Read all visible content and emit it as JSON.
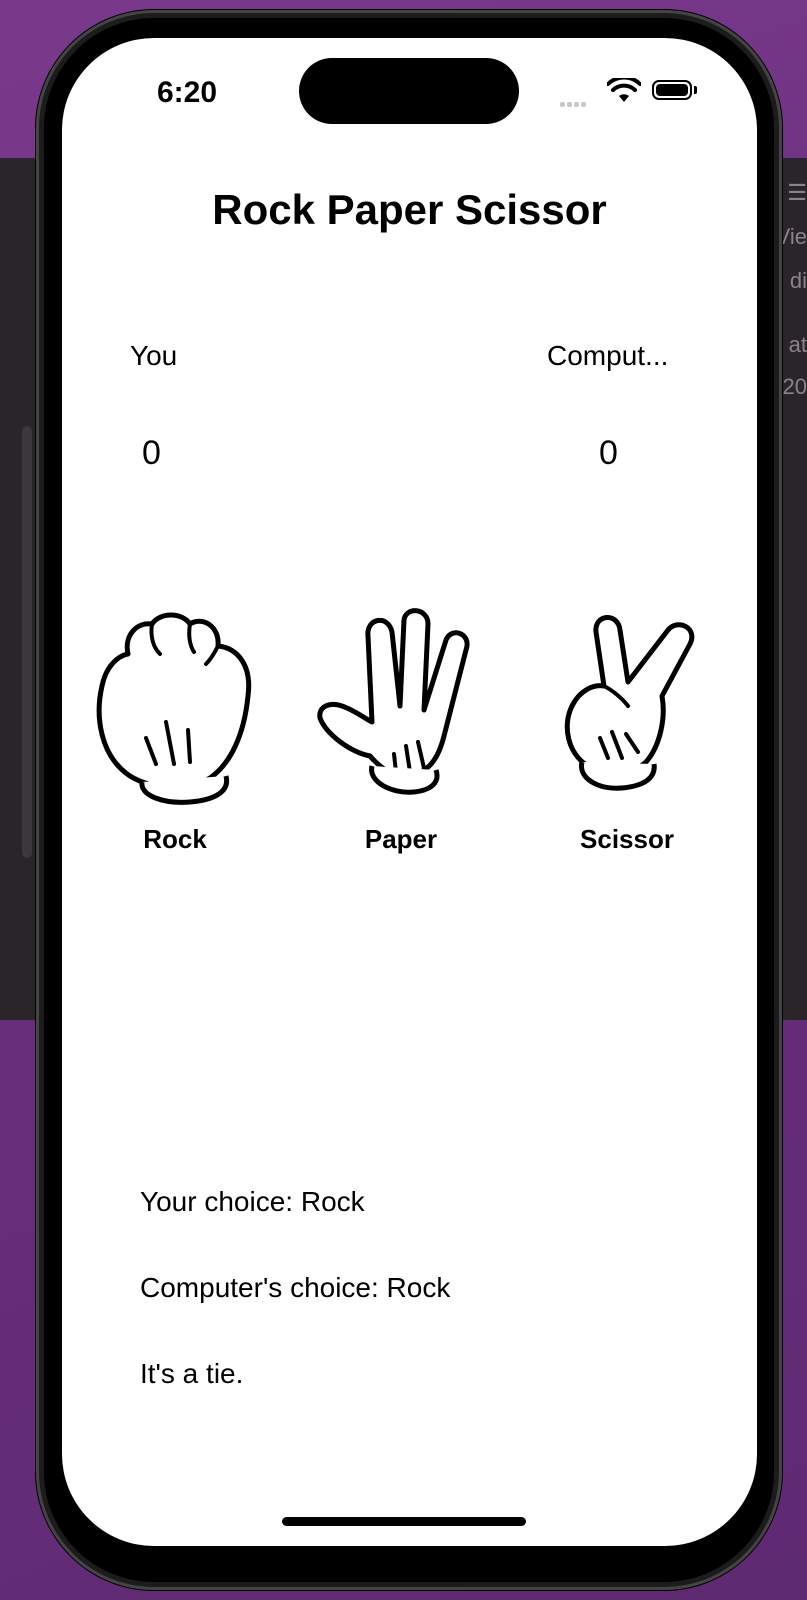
{
  "status_bar": {
    "time": "6:20"
  },
  "app": {
    "title": "Rock Paper Scissor"
  },
  "players": {
    "you": {
      "label": "You",
      "score": "0"
    },
    "computer": {
      "label": "Comput...",
      "score": "0"
    }
  },
  "choices": [
    {
      "label": "Rock",
      "icon": "rock-hand-icon"
    },
    {
      "label": "Paper",
      "icon": "paper-hand-icon"
    },
    {
      "label": "Scissor",
      "icon": "scissor-hand-icon"
    }
  ],
  "results": {
    "your_choice": "Your choice: Rock",
    "computer_choice": "Computer's choice: Rock",
    "outcome": "It's a tie."
  },
  "background": {
    "text_fragments": [
      "☰",
      "Vie",
      "di",
      "at",
      "20"
    ]
  }
}
